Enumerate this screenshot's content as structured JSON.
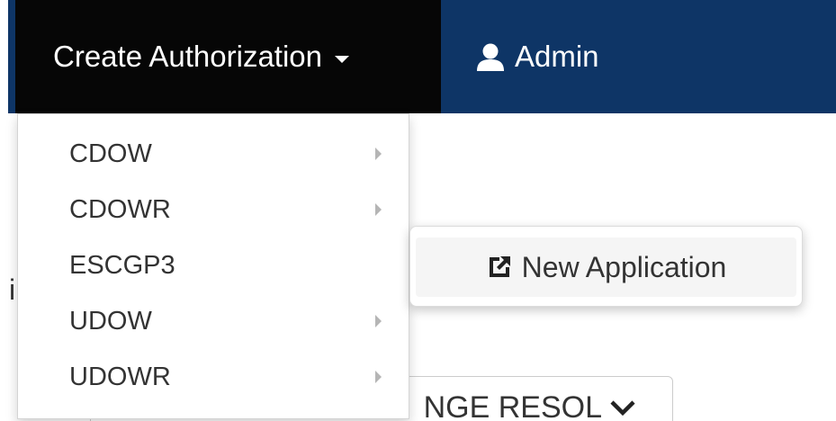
{
  "navbar": {
    "create_label": "Create Authorization",
    "admin_label": "Admin"
  },
  "background": {
    "fragment_text": "i",
    "button_label": "NGE RESOL"
  },
  "dropdown": {
    "items": [
      {
        "label": "CDOW",
        "has_submenu": true
      },
      {
        "label": "CDOWR",
        "has_submenu": true
      },
      {
        "label": "ESCGP3",
        "has_submenu": false
      },
      {
        "label": "UDOW",
        "has_submenu": true
      },
      {
        "label": "UDOWR",
        "has_submenu": true
      }
    ]
  },
  "submenu": {
    "items": [
      {
        "label": "New Application",
        "icon": "external-link-icon"
      }
    ]
  },
  "colors": {
    "nav_create_bg": "#060606",
    "nav_admin_bg": "#0e3566",
    "text": "#333333"
  }
}
